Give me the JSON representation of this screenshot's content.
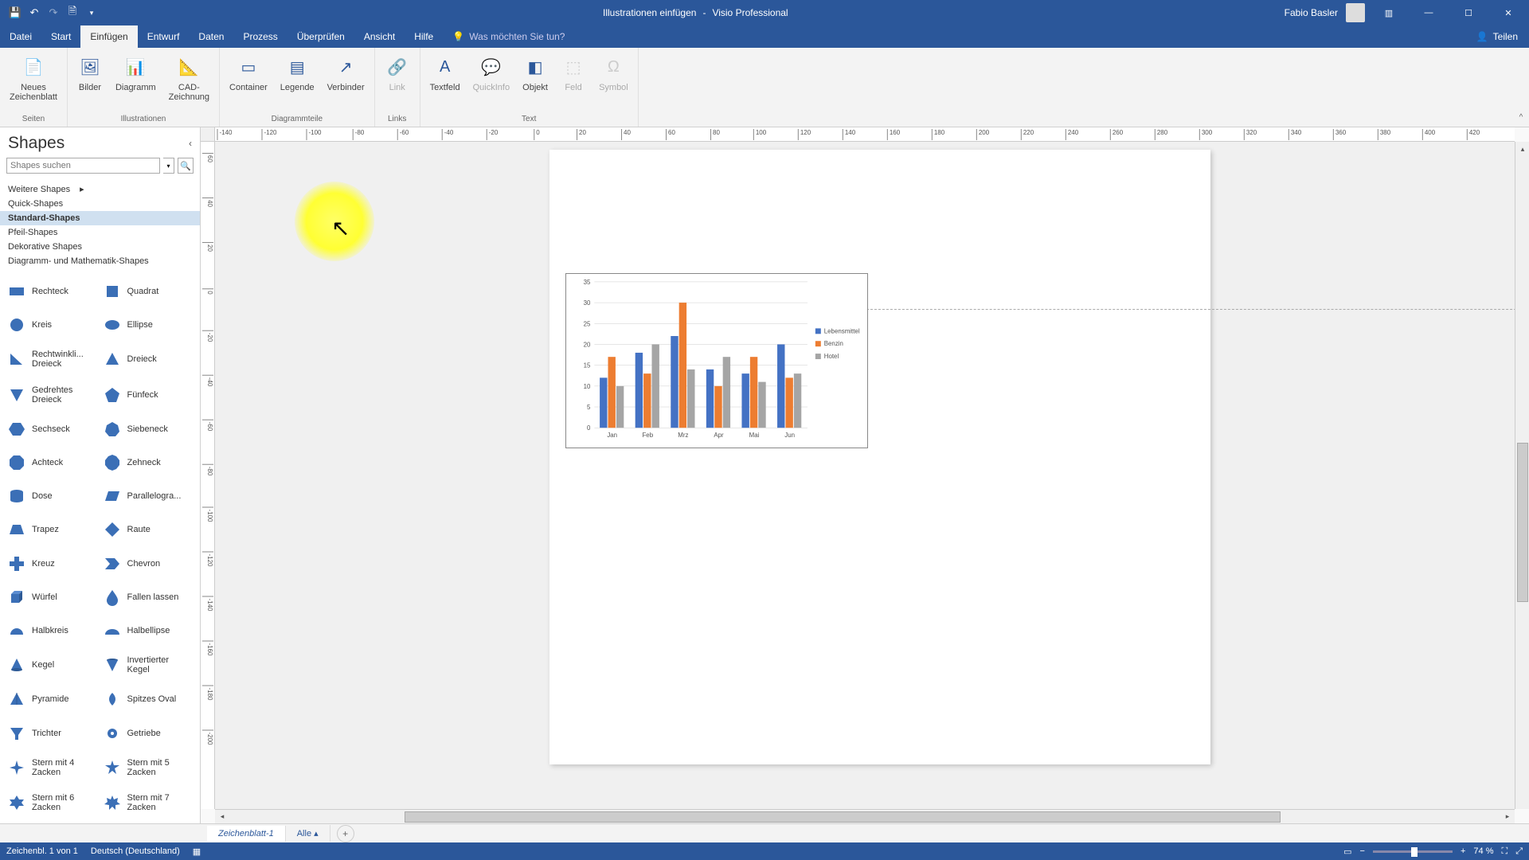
{
  "title": {
    "doc": "Illustrationen einfügen",
    "app": "Visio Professional",
    "user": "Fabio Basler"
  },
  "menu": {
    "tabs": [
      "Datei",
      "Start",
      "Einfügen",
      "Entwurf",
      "Daten",
      "Prozess",
      "Überprüfen",
      "Ansicht",
      "Hilfe"
    ],
    "active": 2,
    "tell_me": "Was möchten Sie tun?",
    "share": "Teilen"
  },
  "ribbon": {
    "groups": [
      {
        "label": "Seiten",
        "items": [
          {
            "name": "Neues\nZeichenblatt",
            "icon": "📄"
          }
        ]
      },
      {
        "label": "Illustrationen",
        "items": [
          {
            "name": "Bilder",
            "icon": "🖼"
          },
          {
            "name": "Diagramm",
            "icon": "📊"
          },
          {
            "name": "CAD-\nZeichnung",
            "icon": "📐"
          }
        ]
      },
      {
        "label": "Diagrammteile",
        "items": [
          {
            "name": "Container",
            "icon": "▭"
          },
          {
            "name": "Legende",
            "icon": "▤"
          },
          {
            "name": "Verbinder",
            "icon": "↗"
          }
        ]
      },
      {
        "label": "Links",
        "items": [
          {
            "name": "Link",
            "icon": "🔗",
            "disabled": true
          }
        ]
      },
      {
        "label": "Text",
        "items": [
          {
            "name": "Textfeld",
            "icon": "A"
          },
          {
            "name": "QuickInfo",
            "icon": "💬",
            "disabled": true
          },
          {
            "name": "Objekt",
            "icon": "◧"
          },
          {
            "name": "Feld",
            "icon": "⬚",
            "disabled": true
          },
          {
            "name": "Symbol",
            "icon": "Ω",
            "disabled": true
          }
        ]
      }
    ]
  },
  "shapes_panel": {
    "title": "Shapes",
    "search_placeholder": "Shapes suchen",
    "stencils": [
      {
        "label": "Weitere Shapes",
        "arrow": true
      },
      {
        "label": "Quick-Shapes"
      },
      {
        "label": "Standard-Shapes",
        "active": true
      },
      {
        "label": "Pfeil-Shapes"
      },
      {
        "label": "Dekorative Shapes"
      },
      {
        "label": "Diagramm- und Mathematik-Shapes"
      }
    ],
    "shapes": [
      {
        "label": "Rechteck",
        "svg": "rect"
      },
      {
        "label": "Quadrat",
        "svg": "square"
      },
      {
        "label": "Kreis",
        "svg": "circle"
      },
      {
        "label": "Ellipse",
        "svg": "ellipse"
      },
      {
        "label": "Rechtwinkli... Dreieck",
        "svg": "rtri"
      },
      {
        "label": "Dreieck",
        "svg": "tri"
      },
      {
        "label": "Gedrehtes Dreieck",
        "svg": "dtri"
      },
      {
        "label": "Fünfeck",
        "svg": "pent"
      },
      {
        "label": "Sechseck",
        "svg": "hex"
      },
      {
        "label": "Siebeneck",
        "svg": "hept"
      },
      {
        "label": "Achteck",
        "svg": "oct"
      },
      {
        "label": "Zehneck",
        "svg": "dec"
      },
      {
        "label": "Dose",
        "svg": "cyl"
      },
      {
        "label": "Parallelogra...",
        "svg": "para"
      },
      {
        "label": "Trapez",
        "svg": "trap"
      },
      {
        "label": "Raute",
        "svg": "dia"
      },
      {
        "label": "Kreuz",
        "svg": "cross"
      },
      {
        "label": "Chevron",
        "svg": "chev"
      },
      {
        "label": "Würfel",
        "svg": "cube"
      },
      {
        "label": "Fallen lassen",
        "svg": "drop"
      },
      {
        "label": "Halbkreis",
        "svg": "hcirc"
      },
      {
        "label": "Halbellipse",
        "svg": "hellipse"
      },
      {
        "label": "Kegel",
        "svg": "cone"
      },
      {
        "label": "Invertierter Kegel",
        "svg": "icone"
      },
      {
        "label": "Pyramide",
        "svg": "pyr"
      },
      {
        "label": "Spitzes Oval",
        "svg": "soval"
      },
      {
        "label": "Trichter",
        "svg": "funnel"
      },
      {
        "label": "Getriebe",
        "svg": "gear"
      },
      {
        "label": "Stern mit 4 Zacken",
        "svg": "star4"
      },
      {
        "label": "Stern mit 5 Zacken",
        "svg": "star5"
      },
      {
        "label": "Stern mit 6 Zacken",
        "svg": "star6"
      },
      {
        "label": "Stern mit 7 Zacken",
        "svg": "star7"
      }
    ]
  },
  "ruler": {
    "h": [
      "-140",
      "-120",
      "-100",
      "-80",
      "-60",
      "-40",
      "-20",
      "0",
      "20",
      "40",
      "60",
      "80",
      "100",
      "120",
      "140",
      "160",
      "180",
      "200",
      "220",
      "240",
      "260",
      "280",
      "300",
      "320",
      "340",
      "360",
      "380",
      "400",
      "420"
    ],
    "v": [
      "60",
      "40",
      "20",
      "0",
      "-20",
      "-40",
      "-60",
      "-80",
      "-100",
      "-120",
      "-140",
      "-160",
      "-180",
      "-200"
    ]
  },
  "chart_data": {
    "type": "bar",
    "categories": [
      "Jan",
      "Feb",
      "Mrz",
      "Apr",
      "Mai",
      "Jun"
    ],
    "series": [
      {
        "name": "Lebensmittel",
        "color": "#4472c4",
        "values": [
          12,
          18,
          22,
          14,
          13,
          20
        ]
      },
      {
        "name": "Benzin",
        "color": "#ed7d31",
        "values": [
          17,
          13,
          30,
          10,
          17,
          12
        ]
      },
      {
        "name": "Hotel",
        "color": "#a5a5a5",
        "values": [
          10,
          20,
          14,
          17,
          11,
          13
        ]
      }
    ],
    "ylim": [
      0,
      35
    ],
    "yticks": [
      0,
      5,
      10,
      15,
      20,
      25,
      30,
      35
    ]
  },
  "page_tabs": {
    "tabs": [
      "Zeichenblatt-1",
      "Alle"
    ],
    "active": 0
  },
  "status": {
    "page_info": "Zeichenbl. 1 von 1",
    "lang": "Deutsch (Deutschland)",
    "zoom": "74 %"
  }
}
